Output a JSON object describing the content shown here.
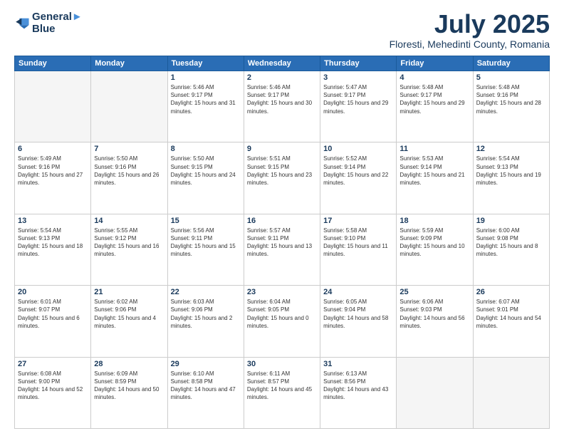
{
  "logo": {
    "line1": "General",
    "line2": "Blue"
  },
  "title": "July 2025",
  "subtitle": "Floresti, Mehedinti County, Romania",
  "days_of_week": [
    "Sunday",
    "Monday",
    "Tuesday",
    "Wednesday",
    "Thursday",
    "Friday",
    "Saturday"
  ],
  "weeks": [
    [
      {
        "day": "",
        "empty": true
      },
      {
        "day": "",
        "empty": true
      },
      {
        "day": "1",
        "sunrise": "Sunrise: 5:46 AM",
        "sunset": "Sunset: 9:17 PM",
        "daylight": "Daylight: 15 hours and 31 minutes."
      },
      {
        "day": "2",
        "sunrise": "Sunrise: 5:46 AM",
        "sunset": "Sunset: 9:17 PM",
        "daylight": "Daylight: 15 hours and 30 minutes."
      },
      {
        "day": "3",
        "sunrise": "Sunrise: 5:47 AM",
        "sunset": "Sunset: 9:17 PM",
        "daylight": "Daylight: 15 hours and 29 minutes."
      },
      {
        "day": "4",
        "sunrise": "Sunrise: 5:48 AM",
        "sunset": "Sunset: 9:17 PM",
        "daylight": "Daylight: 15 hours and 29 minutes."
      },
      {
        "day": "5",
        "sunrise": "Sunrise: 5:48 AM",
        "sunset": "Sunset: 9:16 PM",
        "daylight": "Daylight: 15 hours and 28 minutes."
      }
    ],
    [
      {
        "day": "6",
        "sunrise": "Sunrise: 5:49 AM",
        "sunset": "Sunset: 9:16 PM",
        "daylight": "Daylight: 15 hours and 27 minutes."
      },
      {
        "day": "7",
        "sunrise": "Sunrise: 5:50 AM",
        "sunset": "Sunset: 9:16 PM",
        "daylight": "Daylight: 15 hours and 26 minutes."
      },
      {
        "day": "8",
        "sunrise": "Sunrise: 5:50 AM",
        "sunset": "Sunset: 9:15 PM",
        "daylight": "Daylight: 15 hours and 24 minutes."
      },
      {
        "day": "9",
        "sunrise": "Sunrise: 5:51 AM",
        "sunset": "Sunset: 9:15 PM",
        "daylight": "Daylight: 15 hours and 23 minutes."
      },
      {
        "day": "10",
        "sunrise": "Sunrise: 5:52 AM",
        "sunset": "Sunset: 9:14 PM",
        "daylight": "Daylight: 15 hours and 22 minutes."
      },
      {
        "day": "11",
        "sunrise": "Sunrise: 5:53 AM",
        "sunset": "Sunset: 9:14 PM",
        "daylight": "Daylight: 15 hours and 21 minutes."
      },
      {
        "day": "12",
        "sunrise": "Sunrise: 5:54 AM",
        "sunset": "Sunset: 9:13 PM",
        "daylight": "Daylight: 15 hours and 19 minutes."
      }
    ],
    [
      {
        "day": "13",
        "sunrise": "Sunrise: 5:54 AM",
        "sunset": "Sunset: 9:13 PM",
        "daylight": "Daylight: 15 hours and 18 minutes."
      },
      {
        "day": "14",
        "sunrise": "Sunrise: 5:55 AM",
        "sunset": "Sunset: 9:12 PM",
        "daylight": "Daylight: 15 hours and 16 minutes."
      },
      {
        "day": "15",
        "sunrise": "Sunrise: 5:56 AM",
        "sunset": "Sunset: 9:11 PM",
        "daylight": "Daylight: 15 hours and 15 minutes."
      },
      {
        "day": "16",
        "sunrise": "Sunrise: 5:57 AM",
        "sunset": "Sunset: 9:11 PM",
        "daylight": "Daylight: 15 hours and 13 minutes."
      },
      {
        "day": "17",
        "sunrise": "Sunrise: 5:58 AM",
        "sunset": "Sunset: 9:10 PM",
        "daylight": "Daylight: 15 hours and 11 minutes."
      },
      {
        "day": "18",
        "sunrise": "Sunrise: 5:59 AM",
        "sunset": "Sunset: 9:09 PM",
        "daylight": "Daylight: 15 hours and 10 minutes."
      },
      {
        "day": "19",
        "sunrise": "Sunrise: 6:00 AM",
        "sunset": "Sunset: 9:08 PM",
        "daylight": "Daylight: 15 hours and 8 minutes."
      }
    ],
    [
      {
        "day": "20",
        "sunrise": "Sunrise: 6:01 AM",
        "sunset": "Sunset: 9:07 PM",
        "daylight": "Daylight: 15 hours and 6 minutes."
      },
      {
        "day": "21",
        "sunrise": "Sunrise: 6:02 AM",
        "sunset": "Sunset: 9:06 PM",
        "daylight": "Daylight: 15 hours and 4 minutes."
      },
      {
        "day": "22",
        "sunrise": "Sunrise: 6:03 AM",
        "sunset": "Sunset: 9:06 PM",
        "daylight": "Daylight: 15 hours and 2 minutes."
      },
      {
        "day": "23",
        "sunrise": "Sunrise: 6:04 AM",
        "sunset": "Sunset: 9:05 PM",
        "daylight": "Daylight: 15 hours and 0 minutes."
      },
      {
        "day": "24",
        "sunrise": "Sunrise: 6:05 AM",
        "sunset": "Sunset: 9:04 PM",
        "daylight": "Daylight: 14 hours and 58 minutes."
      },
      {
        "day": "25",
        "sunrise": "Sunrise: 6:06 AM",
        "sunset": "Sunset: 9:03 PM",
        "daylight": "Daylight: 14 hours and 56 minutes."
      },
      {
        "day": "26",
        "sunrise": "Sunrise: 6:07 AM",
        "sunset": "Sunset: 9:01 PM",
        "daylight": "Daylight: 14 hours and 54 minutes."
      }
    ],
    [
      {
        "day": "27",
        "sunrise": "Sunrise: 6:08 AM",
        "sunset": "Sunset: 9:00 PM",
        "daylight": "Daylight: 14 hours and 52 minutes."
      },
      {
        "day": "28",
        "sunrise": "Sunrise: 6:09 AM",
        "sunset": "Sunset: 8:59 PM",
        "daylight": "Daylight: 14 hours and 50 minutes."
      },
      {
        "day": "29",
        "sunrise": "Sunrise: 6:10 AM",
        "sunset": "Sunset: 8:58 PM",
        "daylight": "Daylight: 14 hours and 47 minutes."
      },
      {
        "day": "30",
        "sunrise": "Sunrise: 6:11 AM",
        "sunset": "Sunset: 8:57 PM",
        "daylight": "Daylight: 14 hours and 45 minutes."
      },
      {
        "day": "31",
        "sunrise": "Sunrise: 6:13 AM",
        "sunset": "Sunset: 8:56 PM",
        "daylight": "Daylight: 14 hours and 43 minutes."
      },
      {
        "day": "",
        "empty": true
      },
      {
        "day": "",
        "empty": true
      }
    ]
  ]
}
